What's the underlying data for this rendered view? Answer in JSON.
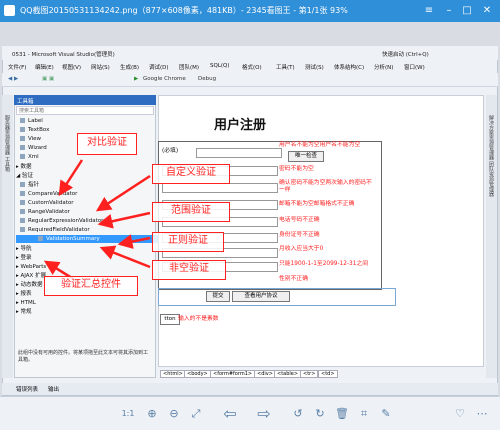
{
  "viewer": {
    "title": "QQ截图20150531134242.png（877×608像素，481KB）- 2345看图王 - 第1/1张 93%",
    "zoom_label": "1:1"
  },
  "vs": {
    "title": "0531 - Microsoft Visual Studio(管理员)",
    "quick_launch": "快速启动 (Ctrl+Q)",
    "menu": [
      "文件(F)",
      "编辑(E)",
      "视图(V)",
      "网站(S)",
      "生成(B)",
      "调试(D)",
      "团队(M)",
      "SQL(Q)",
      "格式(O)",
      "工具(T)",
      "测试(S)",
      "体系结构(C)",
      "分析(N)",
      "窗口(W)"
    ],
    "browser": "Google Chrome",
    "config": "Debug",
    "side_left": "服务器资源管理器 工具箱",
    "side_right": "解决方案资源管理器 团队资源管理器"
  },
  "toolbox": {
    "title": "工具箱",
    "search_placeholder": "搜索工具箱",
    "items": [
      {
        "label": "Label"
      },
      {
        "label": "TextBox"
      },
      {
        "label": "View"
      },
      {
        "label": "Wizard"
      },
      {
        "label": "Xml"
      },
      {
        "label": "▸ 数据"
      },
      {
        "label": "◢ 验证"
      },
      {
        "label": "指针"
      },
      {
        "label": "CompareValidator"
      },
      {
        "label": "CustomValidator"
      },
      {
        "label": "RangeValidator"
      },
      {
        "label": "RegularExpressionValidator"
      },
      {
        "label": "RequiredFieldValidator"
      },
      {
        "label": "ValidationSummary"
      },
      {
        "label": "▸ 导航"
      },
      {
        "label": "▸ 登录"
      },
      {
        "label": "▸ WebParts"
      },
      {
        "label": "▸ AJAX 扩展"
      },
      {
        "label": "▸ 动态数据"
      },
      {
        "label": "▸ 报表"
      },
      {
        "label": "▸ HTML"
      },
      {
        "label": "▸ 常规"
      }
    ],
    "hint": "此组中没有可用的控件。将某项拖至此文本可将其添加到工具箱。"
  },
  "form": {
    "title": "用户注册",
    "required_label": "(必填)",
    "check_button": "唯一检查",
    "errors": [
      "用户名不能为空用户名不能为空",
      "密码不能为空",
      "确认密码不能为空两次输入的密码不一样",
      "邮箱不能为空邮箱格式不正确",
      "电话号码不正确",
      "身份证号不正确",
      "月收入应当大于0",
      "只能1900-1-1至2099-12-31之间",
      "性别不正确"
    ],
    "submit": "提交",
    "read_agreement": "查看用户协议",
    "button_fragment": "tton",
    "bottom_error": "输入的不是素数"
  },
  "annotations": [
    "对比验证",
    "自定义验证",
    "范围验证",
    "正则验证",
    "非空验证",
    "验证汇总控件"
  ],
  "breadcrumb": [
    "<html>",
    "<body>",
    "<form#form1>",
    "<div>",
    "<table>",
    "<tr>",
    "<td>"
  ],
  "bottom_tabs": [
    "错误列表",
    "输出"
  ],
  "colors": {
    "accent": "#2f8fd8",
    "annotation": "#ff2020",
    "selection": "#3399ff"
  }
}
